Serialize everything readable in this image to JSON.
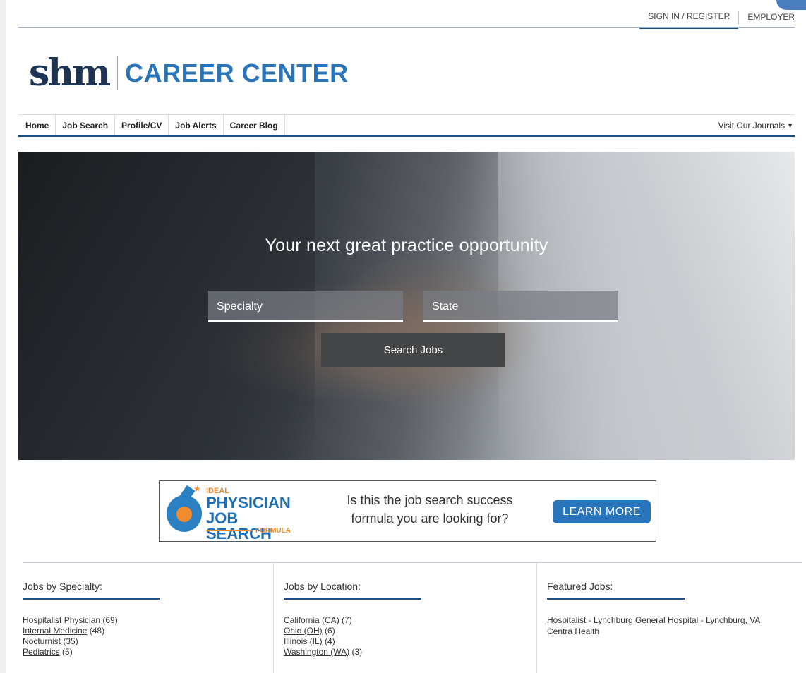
{
  "topbar": {
    "sign_in": "SIGN IN / REGISTER",
    "employer": "EMPLOYER"
  },
  "logo": {
    "mark": "shm",
    "text": "CAREER CENTER"
  },
  "nav": {
    "items": [
      "Home",
      "Job Search",
      "Profile/CV",
      "Job Alerts",
      "Career Blog"
    ],
    "journals": "Visit Our Journals"
  },
  "hero": {
    "title": "Your next great practice opportunity",
    "specialty_placeholder": "Specialty",
    "state_placeholder": "State",
    "search_button": "Search Jobs"
  },
  "banner": {
    "logo_ideal": "IDEAL",
    "logo_physician": "PHYSICIAN",
    "logo_job_search": "JOB SEARCH",
    "logo_formula": "FORMULA",
    "text": "Is this the job search success formula you are looking for?",
    "button": "LEARN MORE"
  },
  "specialty": {
    "heading": "Jobs by Specialty:",
    "items": [
      {
        "label": "Hospitalist Physician",
        "count": "(69)"
      },
      {
        "label": "Internal Medicine",
        "count": "(48)"
      },
      {
        "label": "Nocturnist",
        "count": "(35)"
      },
      {
        "label": "Pediatrics",
        "count": "(5)"
      }
    ]
  },
  "location": {
    "heading": "Jobs by Location:",
    "items": [
      {
        "label": "California (CA)",
        "count": "(7)"
      },
      {
        "label": "Ohio (OH)",
        "count": "(6)"
      },
      {
        "label": "Illinois (IL)",
        "count": "(4)"
      },
      {
        "label": "Washington (WA)",
        "count": "(3)"
      }
    ]
  },
  "featured": {
    "heading": "Featured Jobs:",
    "jobs": [
      {
        "title": "Hospitalist - Lynchburg General Hospital - Lynchburg, VA",
        "company": "Centra Health"
      }
    ]
  }
}
